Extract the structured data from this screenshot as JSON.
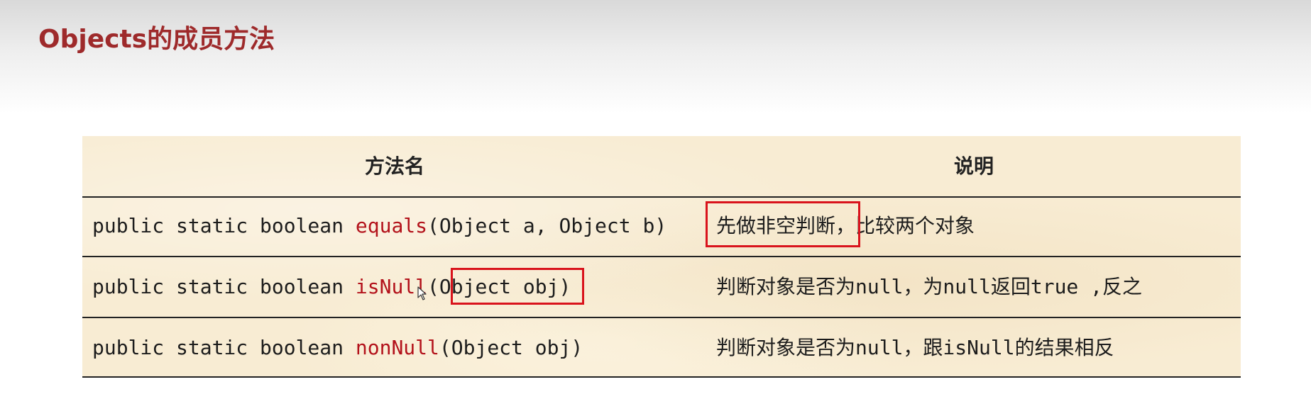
{
  "slide": {
    "title": "Objects的成员方法"
  },
  "table": {
    "headers": {
      "method_name": "方法名",
      "description": "说明"
    },
    "rows": [
      {
        "prefix": "public static boolean ",
        "method": "equals",
        "params": "(Object a, Object b)",
        "description": "先做非空判断，比较两个对象"
      },
      {
        "prefix": "public static boolean ",
        "method": "isNull",
        "params": "(Object obj)",
        "description": "判断对象是否为null，为null返回true ,反之"
      },
      {
        "prefix": "public static boolean ",
        "method": "nonNull",
        "params": "(Object obj)",
        "description": "判断对象是否为null，跟isNull的结果相反"
      }
    ]
  },
  "colors": {
    "title": "#9e2a2b",
    "method_name": "#b3121b",
    "highlight_box": "#d9131c",
    "table_background": "#f8ecd3"
  }
}
